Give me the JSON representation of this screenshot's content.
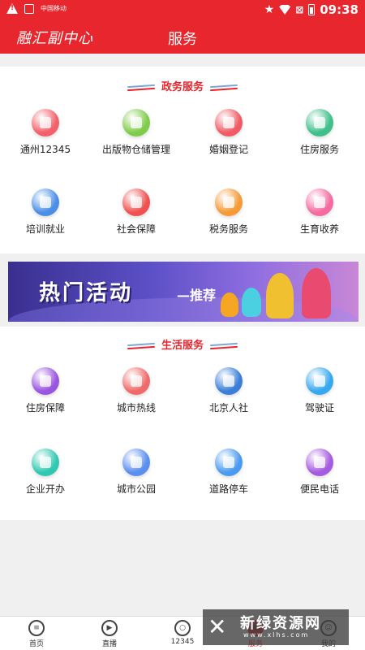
{
  "status_bar": {
    "time": "09:38",
    "carrier_small": "中国移动"
  },
  "header": {
    "logo_text": "融汇副中心",
    "title": "服务"
  },
  "gov_section": {
    "title": "政务服务",
    "items": [
      {
        "label": "通州12345",
        "icon": "hotline-icon",
        "color": "#f2606a"
      },
      {
        "label": "出版物仓储管理",
        "icon": "warehouse-icon",
        "color": "#7fcc4a"
      },
      {
        "label": "婚姻登记",
        "icon": "heart-icon",
        "color": "#f05a64"
      },
      {
        "label": "住房服务",
        "icon": "building-icon",
        "color": "#3fbf8a"
      },
      {
        "label": "培训就业",
        "icon": "people-icon",
        "color": "#4a8ee8"
      },
      {
        "label": "社会保障",
        "icon": "id-card-icon",
        "color": "#f05050"
      },
      {
        "label": "税务服务",
        "icon": "tax-icon",
        "color": "#f59a36"
      },
      {
        "label": "生育收养",
        "icon": "baby-icon",
        "color": "#f56aa0"
      }
    ]
  },
  "banner": {
    "text": "热门活动",
    "sub": "—推荐"
  },
  "life_section": {
    "title": "生活服务",
    "items": [
      {
        "label": "住房保障",
        "icon": "housing-icon",
        "color": "#9a55e0"
      },
      {
        "label": "城市热线",
        "icon": "phone-book-icon",
        "color": "#f06a6a"
      },
      {
        "label": "北京人社",
        "icon": "family-icon",
        "color": "#3a7ed8"
      },
      {
        "label": "驾驶证",
        "icon": "license-icon",
        "color": "#36a8f0"
      },
      {
        "label": "企业开办",
        "icon": "enterprise-icon",
        "color": "#2fc8b0"
      },
      {
        "label": "城市公园",
        "icon": "park-icon",
        "color": "#5a8ef0"
      },
      {
        "label": "道路停车",
        "icon": "parking-icon",
        "color": "#4a9af0"
      },
      {
        "label": "便民电话",
        "icon": "convenience-phone-icon",
        "color": "#a55ae0"
      }
    ]
  },
  "bottom_nav": [
    {
      "label": "首页",
      "icon": "home-list-icon",
      "active": false
    },
    {
      "label": "直播",
      "icon": "play-icon",
      "active": false
    },
    {
      "label": "12345",
      "icon": "bulb-icon",
      "active": false
    },
    {
      "label": "服务",
      "icon": "service-icon",
      "active": true
    },
    {
      "label": "我的",
      "icon": "profile-icon",
      "active": false
    }
  ],
  "watermark": {
    "name": "新绿资源网",
    "url": "www.xlhs.com"
  },
  "colors": {
    "brand_red": "#e8262d"
  }
}
